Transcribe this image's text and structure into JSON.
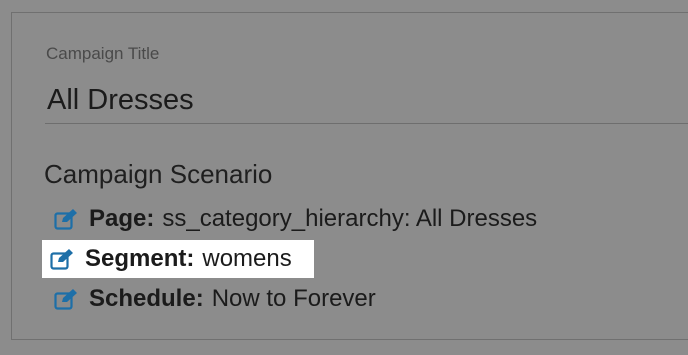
{
  "campaign_title": {
    "label": "Campaign Title",
    "value": "All Dresses"
  },
  "campaign_scenario": {
    "heading": "Campaign Scenario",
    "items": [
      {
        "key": "Page:",
        "value": "ss_category_hierarchy: All Dresses",
        "icon": "edit-icon"
      },
      {
        "key": "Segment:",
        "value": "womens",
        "icon": "edit-icon",
        "highlighted": true
      },
      {
        "key": "Schedule:",
        "value": "Now to Forever",
        "icon": "edit-icon"
      }
    ]
  },
  "colors": {
    "icon": "#1d6fa8",
    "highlight_bg": "#ffffff",
    "overlay_bg": "#8c8c8c"
  }
}
